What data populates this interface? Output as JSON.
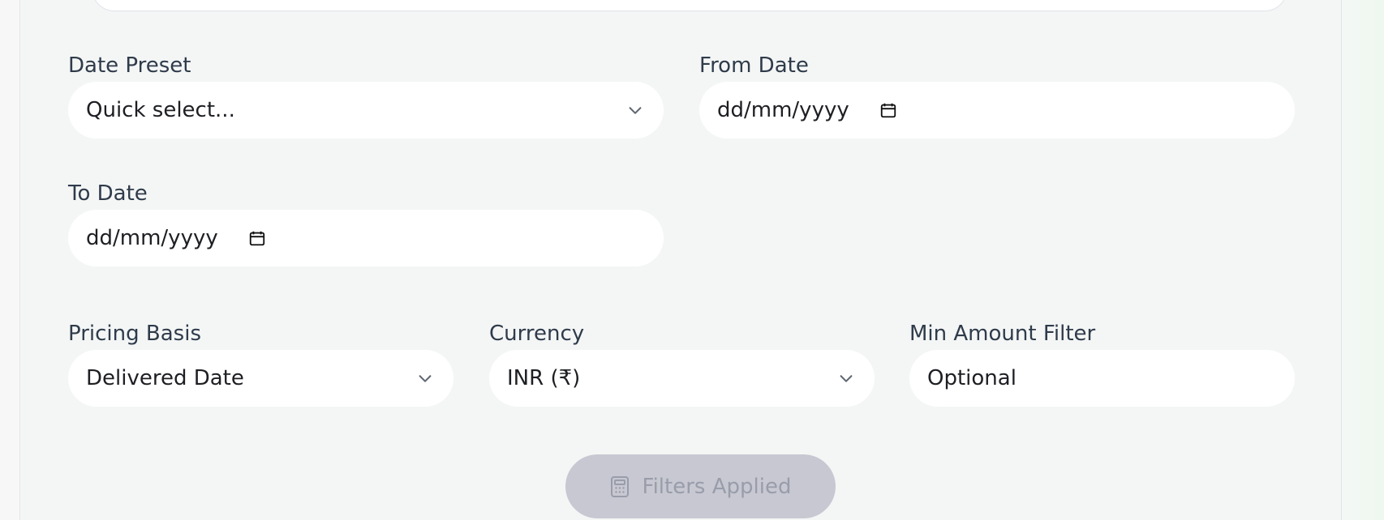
{
  "form": {
    "date_preset": {
      "label": "Date Preset",
      "value": "Quick select..."
    },
    "from_date": {
      "label": "From Date",
      "value": "dd/mm/yyyy"
    },
    "to_date": {
      "label": "To Date",
      "value": "dd/mm/yyyy"
    },
    "pricing_basis": {
      "label": "Pricing Basis",
      "value": "Delivered Date"
    },
    "currency": {
      "label": "Currency",
      "value": "INR (₹)"
    },
    "min_amount": {
      "label": "Min Amount Filter",
      "placeholder": "Optional"
    },
    "submit_button": {
      "label": "Filters Applied"
    }
  },
  "icons": {
    "select_chevron": "chevron-down-icon",
    "date_picker": "calendar-icon",
    "button": "calculator-icon"
  },
  "colors": {
    "label": "#2f3b4a",
    "input_background": "#ffffff",
    "panel_background": "#f4f6f6",
    "disabled_button_background": "#c7c8d1",
    "disabled_button_text": "#999daa",
    "error_text": "#ff2d2d"
  }
}
